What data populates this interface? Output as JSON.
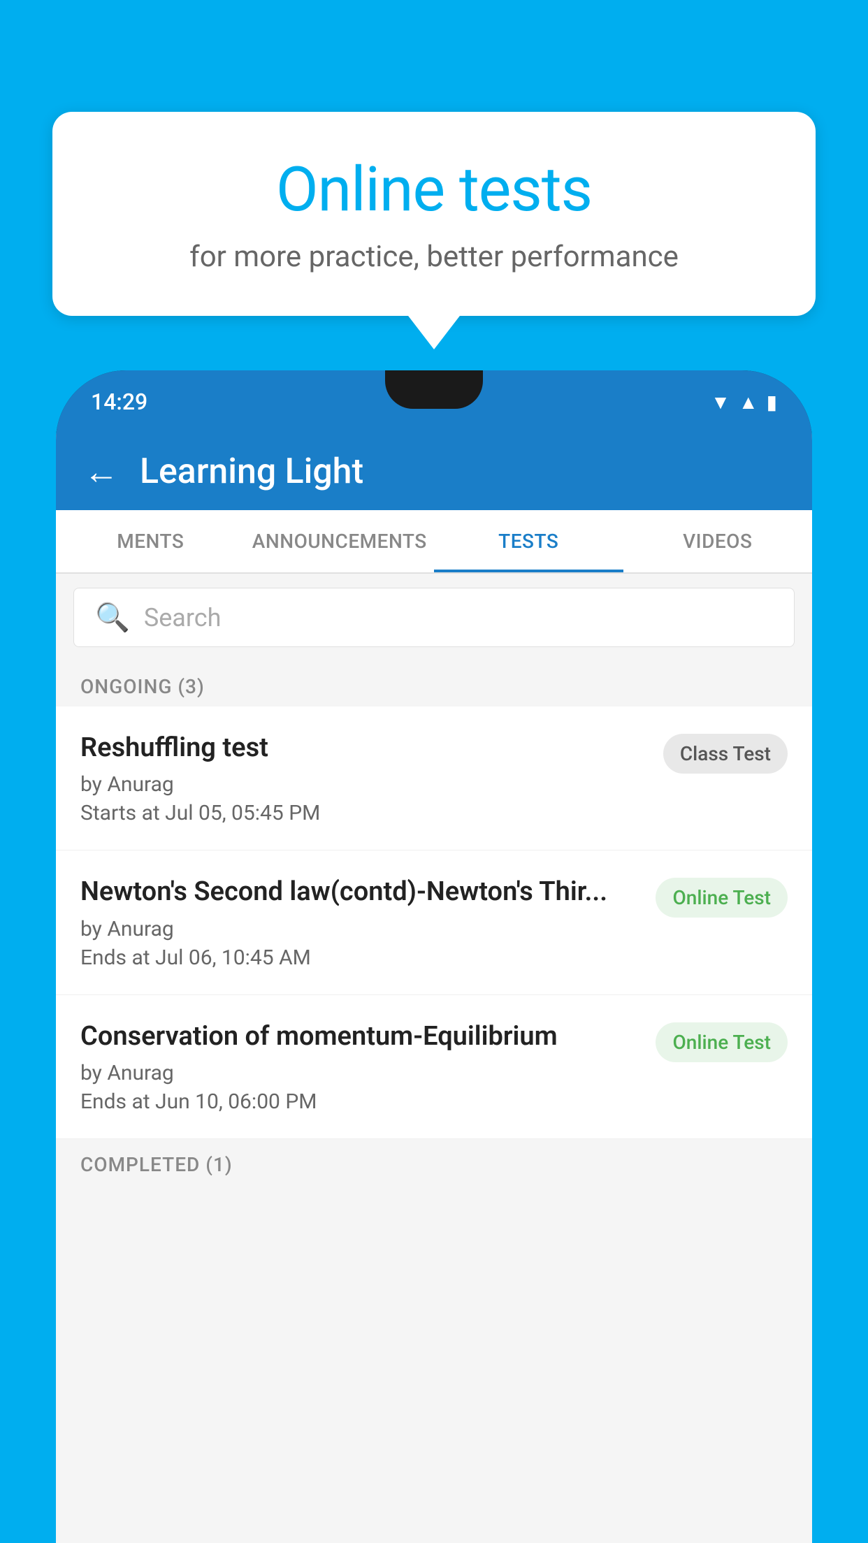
{
  "background_color": "#00AEEF",
  "speech_bubble": {
    "title": "Online tests",
    "subtitle": "for more practice, better performance"
  },
  "phone": {
    "status_bar": {
      "time": "14:29",
      "icons": [
        "wifi",
        "signal",
        "battery"
      ]
    },
    "header": {
      "title": "Learning Light",
      "back_label": "←"
    },
    "tabs": [
      {
        "label": "MENTS",
        "active": false
      },
      {
        "label": "ANNOUNCEMENTS",
        "active": false
      },
      {
        "label": "TESTS",
        "active": true
      },
      {
        "label": "VIDEOS",
        "active": false
      }
    ],
    "search": {
      "placeholder": "Search"
    },
    "ongoing_section": {
      "label": "ONGOING (3)",
      "items": [
        {
          "name": "Reshuffling test",
          "author": "by Anurag",
          "date": "Starts at  Jul 05, 05:45 PM",
          "badge": "Class Test",
          "badge_type": "class"
        },
        {
          "name": "Newton's Second law(contd)-Newton's Thir...",
          "author": "by Anurag",
          "date": "Ends at  Jul 06, 10:45 AM",
          "badge": "Online Test",
          "badge_type": "online"
        },
        {
          "name": "Conservation of momentum-Equilibrium",
          "author": "by Anurag",
          "date": "Ends at  Jun 10, 06:00 PM",
          "badge": "Online Test",
          "badge_type": "online"
        }
      ]
    },
    "completed_section": {
      "label": "COMPLETED (1)"
    }
  }
}
